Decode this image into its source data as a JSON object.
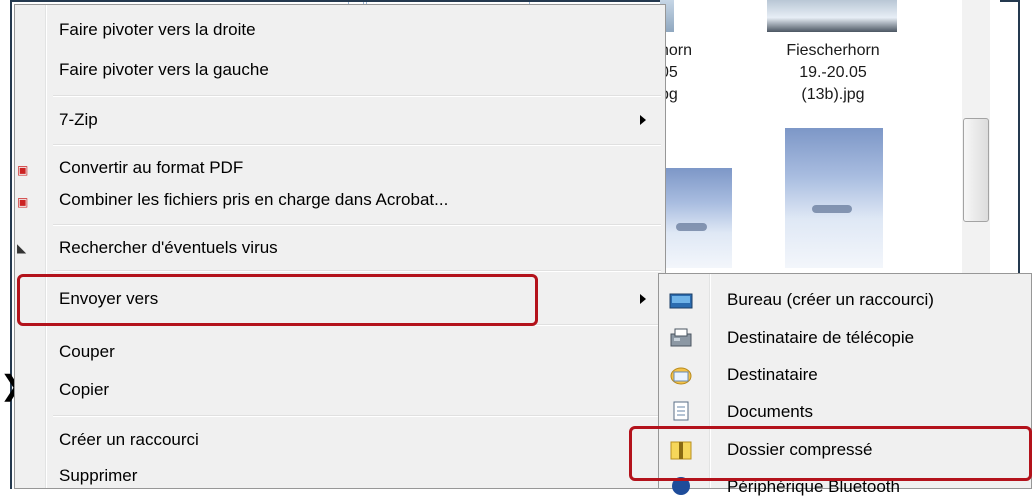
{
  "explorer": {
    "file_left_name": "horn\n05\npg",
    "file_right_name": "Fiescherhorn\n19.-20.05\n(13b).jpg"
  },
  "menu": {
    "rotate_right": "Faire pivoter vers la droite",
    "rotate_left": "Faire pivoter vers la gauche",
    "seven_zip": "7-Zip",
    "convert_pdf": "Convertir au format PDF",
    "combine_acrobat": "Combiner les fichiers pris en charge dans Acrobat...",
    "virus_scan": "Rechercher d'éventuels virus",
    "send_to": "Envoyer vers",
    "cut": "Couper",
    "copy": "Copier",
    "create_shortcut": "Créer un raccourci",
    "delete": "Supprimer"
  },
  "submenu": {
    "desktop": "Bureau (créer un raccourci)",
    "fax": "Destinataire de télécopie",
    "mail": "Destinataire",
    "documents": "Documents",
    "compressed": "Dossier compressé",
    "bluetooth": "Périphérique Bluetooth"
  },
  "colors": {
    "highlight": "#b3121b",
    "frame": "#24394f",
    "menu_bg": "#f0f0f0"
  }
}
